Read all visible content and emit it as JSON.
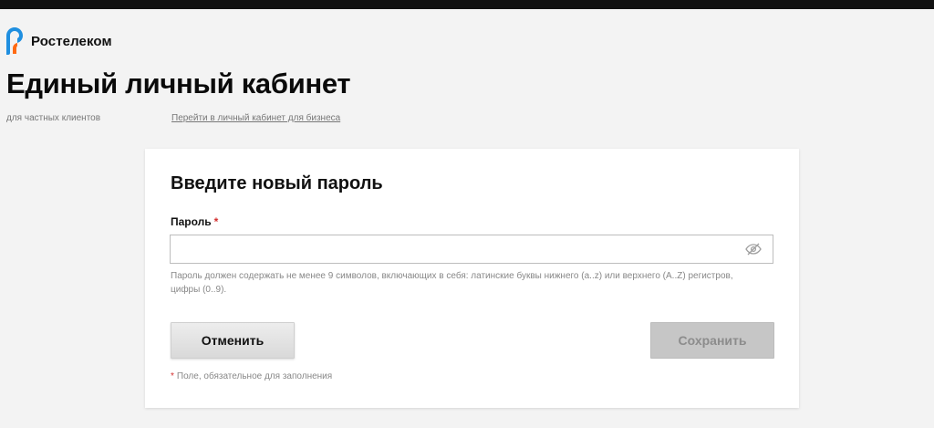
{
  "brand": {
    "name": "Ростелеком"
  },
  "header": {
    "title": "Единый личный кабинет",
    "subtitle": "для частных клиентов",
    "business_link": "Перейти в личный кабинет для бизнеса"
  },
  "form": {
    "title": "Введите новый пароль",
    "password_label": "Пароль",
    "required_mark": "*",
    "password_value": "",
    "hint": "Пароль должен содержать не менее 9 символов, включающих в себя: латинские буквы нижнего (a..z) или верхнего (A..Z) регистров, цифры (0..9).",
    "cancel_label": "Отменить",
    "save_label": "Сохранить",
    "required_note": "Поле, обязательное для заполнения"
  },
  "icons": {
    "logo": "rostelecom-logo-icon",
    "toggle_visibility": "eye-slash-icon"
  },
  "colors": {
    "background": "#f3f3f3",
    "required": "#d32f2f",
    "logo_blue": "#1f8fe0",
    "logo_orange": "#ff6a13"
  }
}
